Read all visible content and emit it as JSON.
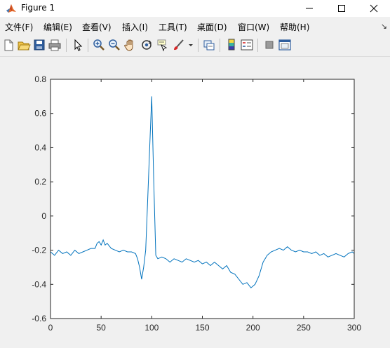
{
  "window": {
    "title": "Figure 1",
    "minimize_glyph": "—",
    "maximize_glyph": "☐",
    "close_glyph": "✕"
  },
  "menu": {
    "items": [
      "文件(F)",
      "编辑(E)",
      "查看(V)",
      "插入(I)",
      "工具(T)",
      "桌面(D)",
      "窗口(W)",
      "帮助(H)"
    ],
    "overflow_glyph": "↘"
  },
  "toolbar": {
    "icons": [
      "new-figure-icon",
      "open-file-icon",
      "save-icon",
      "print-icon",
      "edit-plot-arrow-icon",
      "zoom-in-icon",
      "zoom-out-icon",
      "pan-hand-icon",
      "rotate-3d-icon",
      "data-cursor-icon",
      "brush-icon",
      "link-plot-icon",
      "insert-colorbar-icon",
      "insert-legend-icon",
      "hide-plot-tools-icon",
      "show-plot-tools-icon"
    ]
  },
  "colors": {
    "line": "#0072BD",
    "axes_background": "#ffffff",
    "figure_background": "#f0f0f0"
  },
  "chart_data": {
    "type": "line",
    "xlim": [
      0,
      300
    ],
    "ylim": [
      -0.6,
      0.8
    ],
    "xticks": [
      0,
      50,
      100,
      150,
      200,
      250,
      300
    ],
    "yticks": [
      -0.6,
      -0.4,
      -0.2,
      0,
      0.2,
      0.4,
      0.6,
      0.8
    ],
    "xtick_labels": [
      "0",
      "50",
      "100",
      "150",
      "200",
      "250",
      "300"
    ],
    "ytick_labels": [
      "-0.6",
      "-0.4",
      "-0.2",
      "0",
      "0.2",
      "0.4",
      "0.6",
      "0.8"
    ],
    "grid": false,
    "series": [
      {
        "x": [
          0,
          4,
          8,
          12,
          16,
          20,
          24,
          28,
          32,
          36,
          40,
          44,
          46,
          48,
          50,
          52,
          54,
          56,
          60,
          64,
          68,
          72,
          76,
          80,
          84,
          86,
          88,
          90,
          92,
          94,
          96,
          98,
          100,
          102,
          104,
          106,
          110,
          114,
          118,
          122,
          126,
          130,
          134,
          138,
          142,
          146,
          150,
          154,
          158,
          162,
          166,
          170,
          174,
          178,
          182,
          186,
          190,
          194,
          198,
          202,
          206,
          210,
          214,
          218,
          222,
          226,
          230,
          234,
          238,
          242,
          246,
          250,
          254,
          258,
          262,
          266,
          270,
          274,
          278,
          282,
          286,
          290,
          294,
          298,
          300
        ],
        "y": [
          -0.21,
          -0.23,
          -0.2,
          -0.22,
          -0.21,
          -0.23,
          -0.2,
          -0.22,
          -0.21,
          -0.2,
          -0.19,
          -0.19,
          -0.16,
          -0.15,
          -0.17,
          -0.14,
          -0.17,
          -0.16,
          -0.19,
          -0.2,
          -0.21,
          -0.2,
          -0.21,
          -0.21,
          -0.22,
          -0.25,
          -0.3,
          -0.37,
          -0.3,
          -0.2,
          0.1,
          0.4,
          0.7,
          0.2,
          -0.23,
          -0.25,
          -0.24,
          -0.25,
          -0.27,
          -0.25,
          -0.26,
          -0.27,
          -0.25,
          -0.26,
          -0.27,
          -0.26,
          -0.28,
          -0.27,
          -0.29,
          -0.27,
          -0.29,
          -0.31,
          -0.29,
          -0.33,
          -0.34,
          -0.37,
          -0.4,
          -0.39,
          -0.42,
          -0.4,
          -0.35,
          -0.27,
          -0.23,
          -0.21,
          -0.2,
          -0.19,
          -0.2,
          -0.18,
          -0.2,
          -0.21,
          -0.2,
          -0.21,
          -0.21,
          -0.22,
          -0.21,
          -0.23,
          -0.22,
          -0.24,
          -0.23,
          -0.22,
          -0.23,
          -0.24,
          -0.22,
          -0.21,
          -0.22
        ]
      }
    ]
  }
}
